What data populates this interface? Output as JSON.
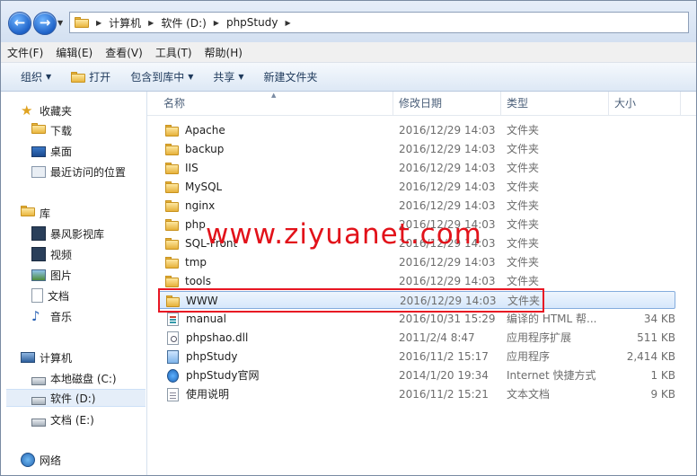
{
  "address": {
    "segments": [
      "计算机",
      "软件 (D:)",
      "phpStudy"
    ]
  },
  "menu": [
    "文件(F)",
    "编辑(E)",
    "查看(V)",
    "工具(T)",
    "帮助(H)"
  ],
  "toolbar": {
    "organize": "组织",
    "open": "打开",
    "include": "包含到库中",
    "share": "共享",
    "newfolder": "新建文件夹"
  },
  "nav": {
    "favorites": "收藏夹",
    "downloads": "下载",
    "desktop": "桌面",
    "recent": "最近访问的位置",
    "libraries": "库",
    "storm": "暴风影视库",
    "videos": "视频",
    "pictures": "图片",
    "docs": "文档",
    "music": "音乐",
    "computer": "计算机",
    "drive_c": "本地磁盘 (C:)",
    "drive_d": "软件 (D:)",
    "drive_e": "文档 (E:)",
    "network": "网络"
  },
  "columns": {
    "name": "名称",
    "date": "修改日期",
    "type": "类型",
    "size": "大小"
  },
  "files": [
    {
      "name": "Apache",
      "date": "2016/12/29 14:03",
      "type": "文件夹",
      "size": "",
      "icon": "folder"
    },
    {
      "name": "backup",
      "date": "2016/12/29 14:03",
      "type": "文件夹",
      "size": "",
      "icon": "folder"
    },
    {
      "name": "IIS",
      "date": "2016/12/29 14:03",
      "type": "文件夹",
      "size": "",
      "icon": "folder"
    },
    {
      "name": "MySQL",
      "date": "2016/12/29 14:03",
      "type": "文件夹",
      "size": "",
      "icon": "folder"
    },
    {
      "name": "nginx",
      "date": "2016/12/29 14:03",
      "type": "文件夹",
      "size": "",
      "icon": "folder"
    },
    {
      "name": "php",
      "date": "2016/12/29 14:03",
      "type": "文件夹",
      "size": "",
      "icon": "folder"
    },
    {
      "name": "SQL-Front",
      "date": "2016/12/29 14:03",
      "type": "文件夹",
      "size": "",
      "icon": "folder"
    },
    {
      "name": "tmp",
      "date": "2016/12/29 14:03",
      "type": "文件夹",
      "size": "",
      "icon": "folder"
    },
    {
      "name": "tools",
      "date": "2016/12/29 14:03",
      "type": "文件夹",
      "size": "",
      "icon": "folder"
    },
    {
      "name": "WWW",
      "date": "2016/12/29 14:03",
      "type": "文件夹",
      "size": "",
      "icon": "folder"
    },
    {
      "name": "manual",
      "date": "2016/10/31 15:29",
      "type": "编译的 HTML 帮...",
      "size": "34 KB",
      "icon": "html"
    },
    {
      "name": "phpshao.dll",
      "date": "2011/2/4 8:47",
      "type": "应用程序扩展",
      "size": "511 KB",
      "icon": "dll"
    },
    {
      "name": "phpStudy",
      "date": "2016/11/2 15:17",
      "type": "应用程序",
      "size": "2,414 KB",
      "icon": "app"
    },
    {
      "name": "phpStudy官网",
      "date": "2014/1/20 19:34",
      "type": "Internet 快捷方式",
      "size": "1 KB",
      "icon": "web"
    },
    {
      "name": "使用说明",
      "date": "2016/11/2 15:21",
      "type": "文本文档",
      "size": "9 KB",
      "icon": "txt"
    }
  ],
  "watermark": "www.ziyuanet.com"
}
